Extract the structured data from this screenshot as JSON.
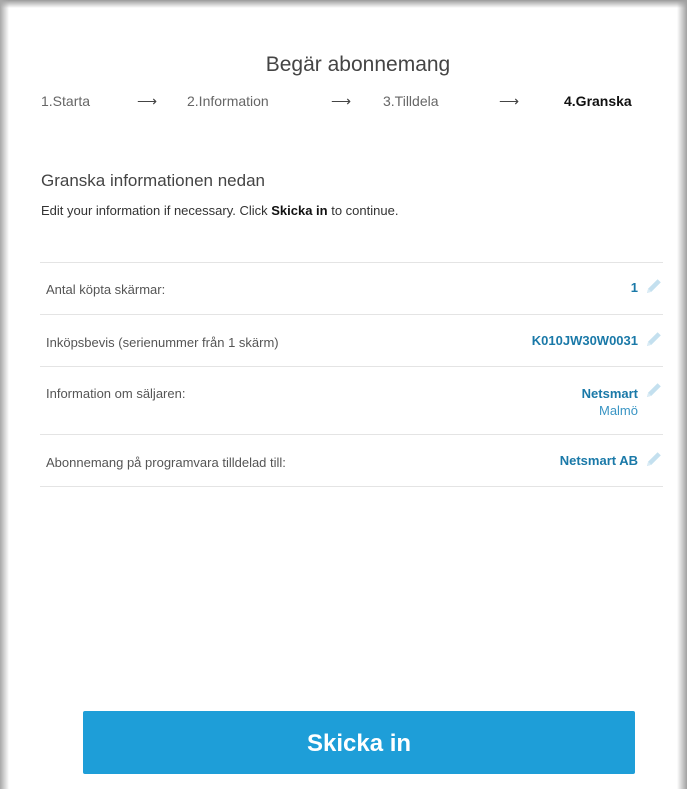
{
  "dialog": {
    "title": "Begär abonnemang"
  },
  "steps": [
    {
      "label": "1.Starta"
    },
    {
      "label": "2.Information"
    },
    {
      "label": "3.Tilldela"
    },
    {
      "label": "4.Granska",
      "active": true
    }
  ],
  "step_arrow": "⟶",
  "review": {
    "heading": "Granska informationen nedan",
    "desc_prefix": "Edit your information if necessary. Click ",
    "desc_bold": "Skicka in",
    "desc_suffix": " to continue."
  },
  "rows": [
    {
      "label": "Antal köpta skärmar:",
      "value": "1"
    },
    {
      "label": "Inköpsbevis (serienummer från 1 skärm)",
      "value": "K010JW30W0031"
    },
    {
      "label": "Information om säljaren:",
      "value": "Netsmart",
      "subvalue": "Malmö"
    },
    {
      "label": "Abonnemang på programvara tilldelad till:",
      "value": "Netsmart AB"
    }
  ],
  "submit": {
    "label": "Skicka in"
  },
  "colors": {
    "accent": "#1e9ed8",
    "value_text": "#1a79a8",
    "edit_icon": "#c4e0ef"
  },
  "icons": {
    "edit": "pencil-icon"
  }
}
